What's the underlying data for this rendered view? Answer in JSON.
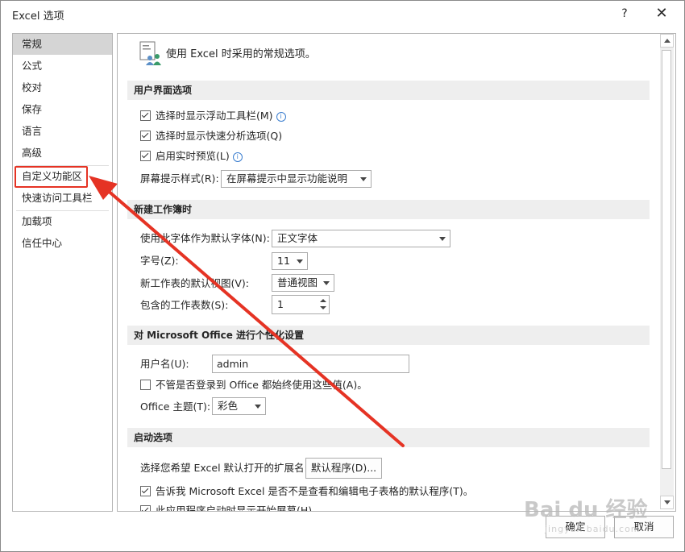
{
  "dialog": {
    "title": "Excel 选项",
    "help": "?",
    "close": "✕"
  },
  "nav": {
    "items": [
      {
        "label": "常规",
        "selected": true
      },
      {
        "label": "公式"
      },
      {
        "label": "校对"
      },
      {
        "label": "保存"
      },
      {
        "label": "语言"
      },
      {
        "label": "高级"
      },
      {
        "label": "自定义功能区",
        "highlighted": true
      },
      {
        "label": "快速访问工具栏"
      },
      {
        "label": "加载项"
      },
      {
        "label": "信任中心"
      }
    ]
  },
  "main": {
    "header": "使用 Excel 时采用的常规选项。",
    "sections": {
      "ui": "用户界面选项",
      "new_wb": "新建工作簿时",
      "personalize": "对 Microsoft Office 进行个性化设置",
      "startup": "启动选项"
    },
    "ui": {
      "mini_toolbar": "选择时显示浮动工具栏(M)",
      "quick_analysis": "选择时显示快速分析选项(Q)",
      "live_preview": "启用实时预览(L)",
      "screentip_label": "屏幕提示样式(R):",
      "screentip_value": "在屏幕提示中显示功能说明"
    },
    "new_wb": {
      "font_label": "使用此字体作为默认字体(N):",
      "font_value": "正文字体",
      "size_label": "字号(Z):",
      "size_value": "11",
      "view_label": "新工作表的默认视图(V):",
      "view_value": "普通视图",
      "sheets_label": "包含的工作表数(S):",
      "sheets_value": "1"
    },
    "personalize": {
      "username_label": "用户名(U):",
      "username_value": "admin",
      "always_use": "不管是否登录到 Office 都始终使用这些值(A)。",
      "theme_label": "Office 主题(T):",
      "theme_value": "彩色"
    },
    "startup": {
      "ext_label": "选择您希望 Excel 默认打开的扩展名:",
      "default_programs": "默认程序(D)...",
      "tell_me": "告诉我 Microsoft Excel 是否不是查看和编辑电子表格的默认程序(T)。",
      "show_start": "此应用程序启动时显示开始屏幕(H)"
    }
  },
  "footer": {
    "ok": "确定",
    "cancel": "取消"
  },
  "watermark": {
    "main": "Bai du 经验",
    "sub": "jingyan.baidu.com"
  },
  "colors": {
    "annotation": "#e53324",
    "section_bg": "#eeeeee",
    "selected_nav": "#d5d5d5"
  }
}
